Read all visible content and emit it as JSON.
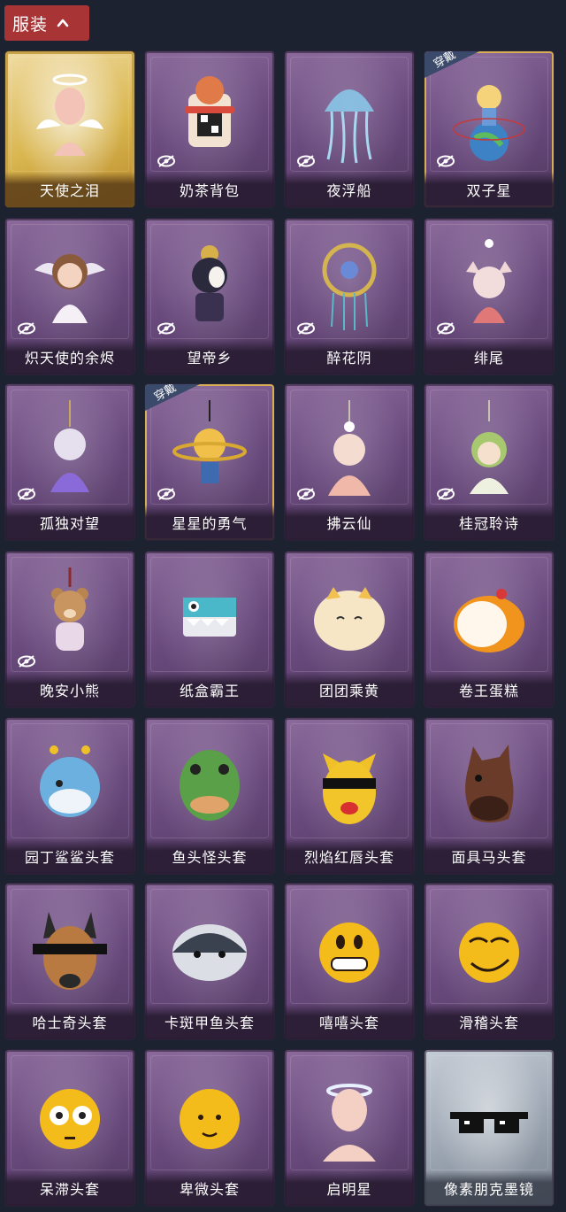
{
  "header": {
    "title": "服装"
  },
  "worn_tag": "穿戴",
  "items": [
    {
      "name": "天使之泪",
      "style": "gold",
      "hidden": false,
      "worn": false,
      "icon": "angel-mannequin-icon"
    },
    {
      "name": "奶茶背包",
      "style": "purple",
      "hidden": true,
      "worn": false,
      "icon": "milk-tea-backpack-icon"
    },
    {
      "name": "夜浮船",
      "style": "purple",
      "hidden": true,
      "worn": false,
      "icon": "jellyfish-icon"
    },
    {
      "name": "双子星",
      "style": "purple",
      "hidden": true,
      "worn": true,
      "icon": "gemini-figure-icon"
    },
    {
      "name": "炽天使的余烬",
      "style": "purple",
      "hidden": true,
      "worn": false,
      "icon": "seraph-figure-icon"
    },
    {
      "name": "望帝乡",
      "style": "purple",
      "hidden": true,
      "worn": false,
      "icon": "mask-figure-icon"
    },
    {
      "name": "醉花阴",
      "style": "purple",
      "hidden": true,
      "worn": false,
      "icon": "dreamcatcher-icon"
    },
    {
      "name": "绯尾",
      "style": "purple",
      "hidden": true,
      "worn": false,
      "icon": "fox-figure-icon"
    },
    {
      "name": "孤独对望",
      "style": "purple",
      "hidden": true,
      "worn": false,
      "icon": "charm-figure-icon"
    },
    {
      "name": "星星的勇气",
      "style": "purple",
      "hidden": true,
      "worn": true,
      "icon": "star-prince-icon"
    },
    {
      "name": "拂云仙",
      "style": "purple",
      "hidden": true,
      "worn": false,
      "icon": "cloud-fairy-icon"
    },
    {
      "name": "桂冠聆诗",
      "style": "purple",
      "hidden": true,
      "worn": false,
      "icon": "laurel-charm-icon"
    },
    {
      "name": "晚安小熊",
      "style": "purple",
      "hidden": true,
      "worn": false,
      "icon": "bear-charm-icon"
    },
    {
      "name": "纸盒霸王",
      "style": "purple",
      "hidden": false,
      "worn": false,
      "icon": "box-dinosaur-icon"
    },
    {
      "name": "团团乘黄",
      "style": "purple",
      "hidden": false,
      "worn": false,
      "icon": "round-creature-icon"
    },
    {
      "name": "卷王蛋糕",
      "style": "purple",
      "hidden": false,
      "worn": false,
      "icon": "roll-cake-icon"
    },
    {
      "name": "园丁鲨鲨头套",
      "style": "purple",
      "hidden": false,
      "worn": false,
      "icon": "shark-head-icon"
    },
    {
      "name": "鱼头怪头套",
      "style": "purple",
      "hidden": false,
      "worn": false,
      "icon": "fish-head-icon"
    },
    {
      "name": "烈焰红唇头套",
      "style": "purple",
      "hidden": false,
      "worn": false,
      "icon": "pikachu-head-icon"
    },
    {
      "name": "面具马头套",
      "style": "purple",
      "hidden": false,
      "worn": false,
      "icon": "horse-head-icon"
    },
    {
      "name": "哈士奇头套",
      "style": "purple",
      "hidden": false,
      "worn": false,
      "icon": "husky-head-icon"
    },
    {
      "name": "卡斑甲鱼头套",
      "style": "purple",
      "hidden": false,
      "worn": false,
      "icon": "whale-head-icon"
    },
    {
      "name": "嘻嘻头套",
      "style": "purple",
      "hidden": false,
      "worn": false,
      "icon": "grin-emoji-icon"
    },
    {
      "name": "滑稽头套",
      "style": "purple",
      "hidden": false,
      "worn": false,
      "icon": "smirk-emoji-icon"
    },
    {
      "name": "呆滞头套",
      "style": "purple",
      "hidden": false,
      "worn": false,
      "icon": "dazed-emoji-icon"
    },
    {
      "name": "卑微头套",
      "style": "purple",
      "hidden": false,
      "worn": false,
      "icon": "shy-emoji-icon"
    },
    {
      "name": "启明星",
      "style": "purple",
      "hidden": false,
      "worn": false,
      "icon": "halo-head-icon"
    },
    {
      "name": "像素朋克墨镜",
      "style": "grey",
      "hidden": false,
      "worn": false,
      "icon": "pixel-sunglasses-icon"
    }
  ]
}
